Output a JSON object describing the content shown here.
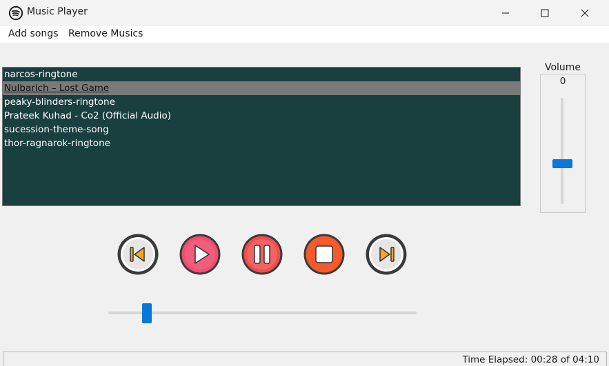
{
  "window": {
    "title": "Music Player"
  },
  "menu": {
    "items": [
      {
        "label": "Add songs"
      },
      {
        "label": "Remove Musics"
      }
    ]
  },
  "playlist": {
    "songs": [
      {
        "title": "narcos-ringtone",
        "selected": false
      },
      {
        "title": "Nulbarich – Lost Game",
        "selected": true
      },
      {
        "title": "peaky-blinders-ringtone",
        "selected": false
      },
      {
        "title": "Prateek Kuhad - Co2 (Official Audio)",
        "selected": false
      },
      {
        "title": "sucession-theme-song",
        "selected": false
      },
      {
        "title": "thor-ragnarok-ringtone",
        "selected": false
      }
    ],
    "background_color": "#193f3f"
  },
  "volume": {
    "label": "Volume",
    "value": "0"
  },
  "controls": [
    {
      "name": "previous-button",
      "icon": "skip-previous-icon",
      "color": "#e6e6e6"
    },
    {
      "name": "play-button",
      "icon": "play-icon",
      "color": "#f04e70"
    },
    {
      "name": "pause-button",
      "icon": "pause-icon",
      "color": "#f04e4e"
    },
    {
      "name": "stop-button",
      "icon": "stop-icon",
      "color": "#f45a2a"
    },
    {
      "name": "next-button",
      "icon": "skip-next-icon",
      "color": "#e6e6e6"
    }
  ],
  "status": {
    "text": "Time Elapsed: 00:28 of 04:10",
    "elapsed": "00:28",
    "total": "04:10"
  },
  "colors": {
    "accent": "#0a78d7"
  }
}
